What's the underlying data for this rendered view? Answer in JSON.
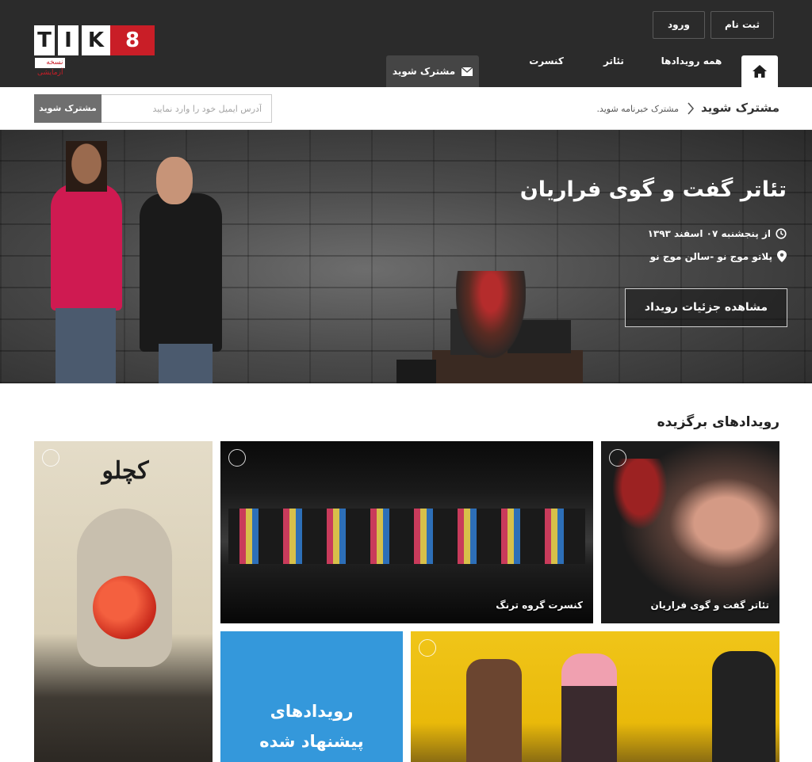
{
  "header": {
    "logo": {
      "letters": [
        "T",
        "I",
        "K",
        "8"
      ],
      "tagline": "نسخه آزمایشی"
    },
    "buttons": {
      "register": "ثبت نام",
      "login": "ورود"
    },
    "nav": {
      "all_events": "همه رویدادها",
      "theater": "تئاتر",
      "concert": "کنسرت",
      "subscribe": "مشترک شوید"
    }
  },
  "subscribe_bar": {
    "title": "مشترک شوید",
    "subtitle": "مشترک خبرنامه شوید.",
    "email_placeholder": "آدرس ایمیل خود را وارد نمایید",
    "button": "مشترک شوید"
  },
  "hero": {
    "title": "تئاتر گفت و گوی فراریان",
    "date": "از پنجشنبه ۰۷ اسفند ۱۳۹۳",
    "venue": "پلاتو موج نو -سالن موج نو",
    "button": "مشاهده جزئیات رویداد"
  },
  "featured": {
    "heading": "رویدادهای برگزیده",
    "tiles": [
      {
        "caption": "تئاتر گفت و گوی فراریان"
      },
      {
        "caption": "کنسرت گروه ترنگ"
      },
      {
        "caption": "",
        "poster_title": "کچلو"
      },
      {
        "caption": "رویدادهای\nپیشنهاد شده"
      },
      {
        "caption": ""
      }
    ]
  },
  "colors": {
    "brand_red": "#c91e27",
    "header_bg": "#2b2b2b",
    "blue_tile": "#3498db"
  }
}
